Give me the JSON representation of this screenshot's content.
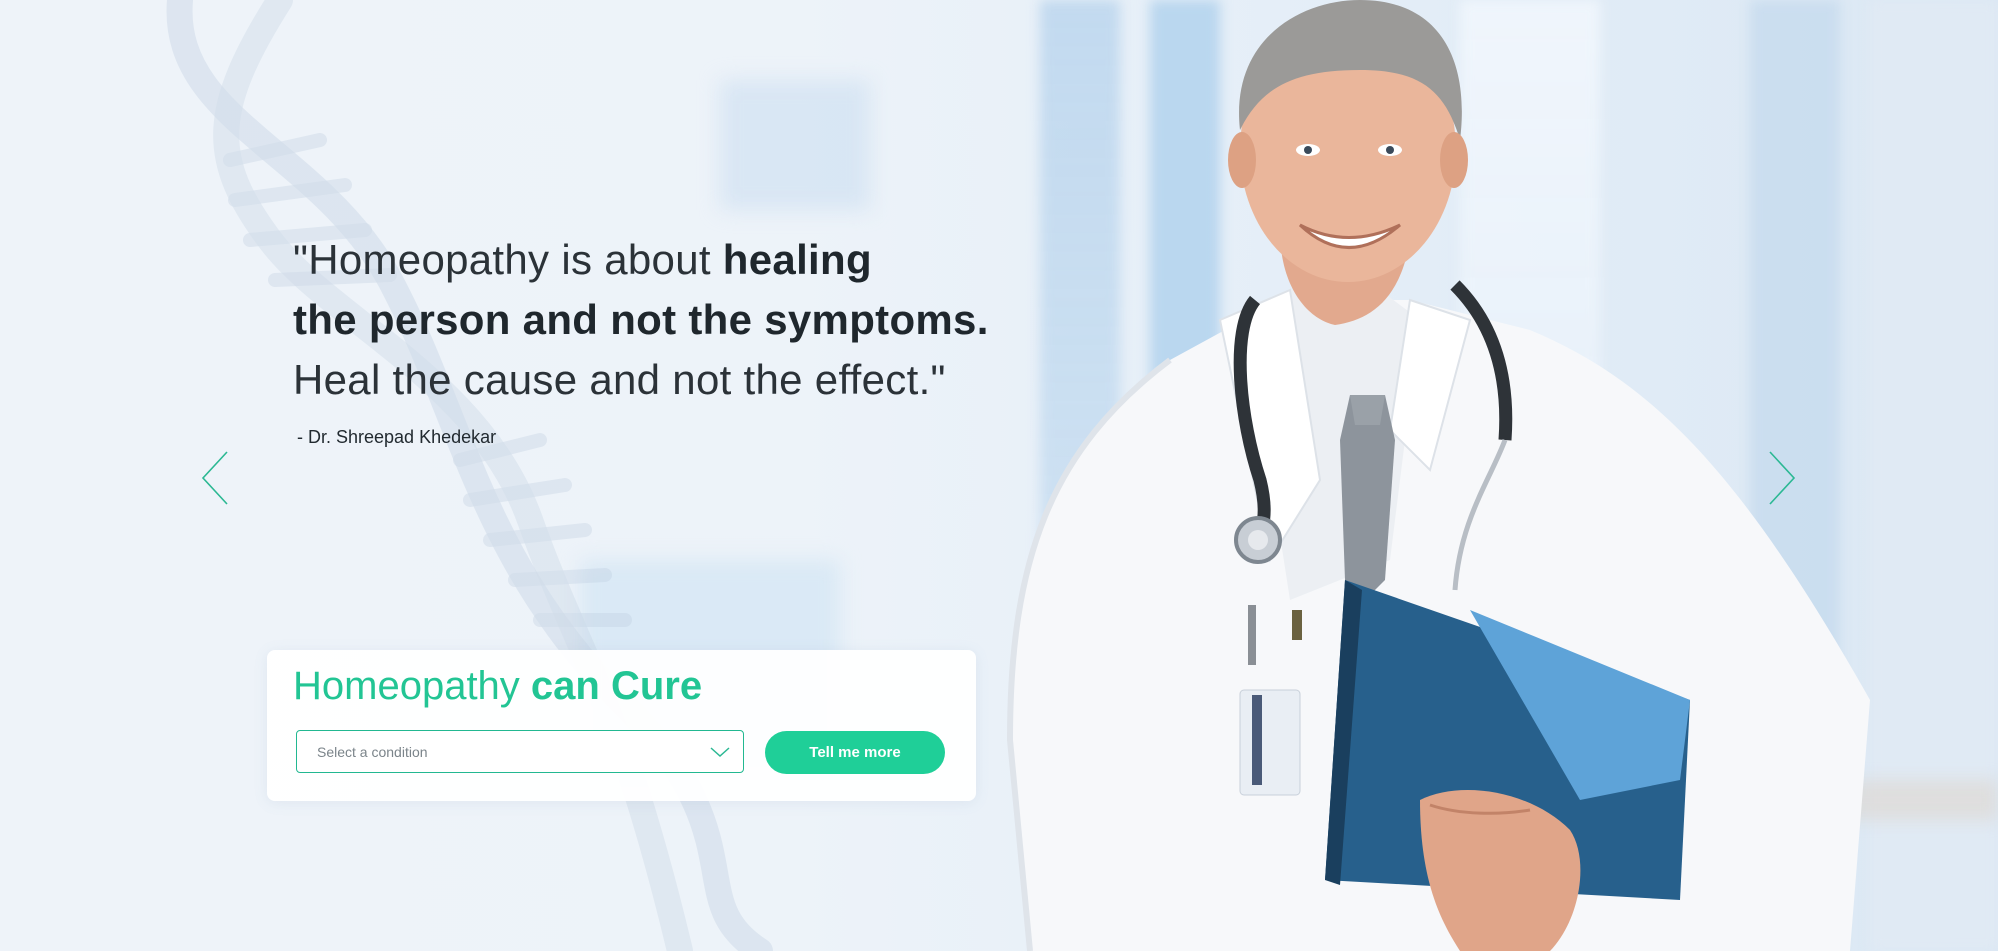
{
  "hero": {
    "quote": {
      "line1_light": "\"Homeopathy is about ",
      "line1_bold": "healing",
      "line2_bold": "the person and not the symptoms.",
      "line3_light": "Heal the cause and not the effect.\""
    },
    "author": "- Dr. Shreepad Khedekar",
    "prev_icon": "chevron-left-icon",
    "next_icon": "chevron-right-icon"
  },
  "cure_card": {
    "title_light": "Homeopathy ",
    "title_bold": "can Cure",
    "select_placeholder": "Select a condition",
    "select_icon": "chevron-down-icon",
    "button_label": "Tell me more"
  },
  "colors": {
    "accent": "#1fcf98",
    "accent_text": "#22c594",
    "text_dark": "#222a30",
    "background": "#eef3f9"
  }
}
